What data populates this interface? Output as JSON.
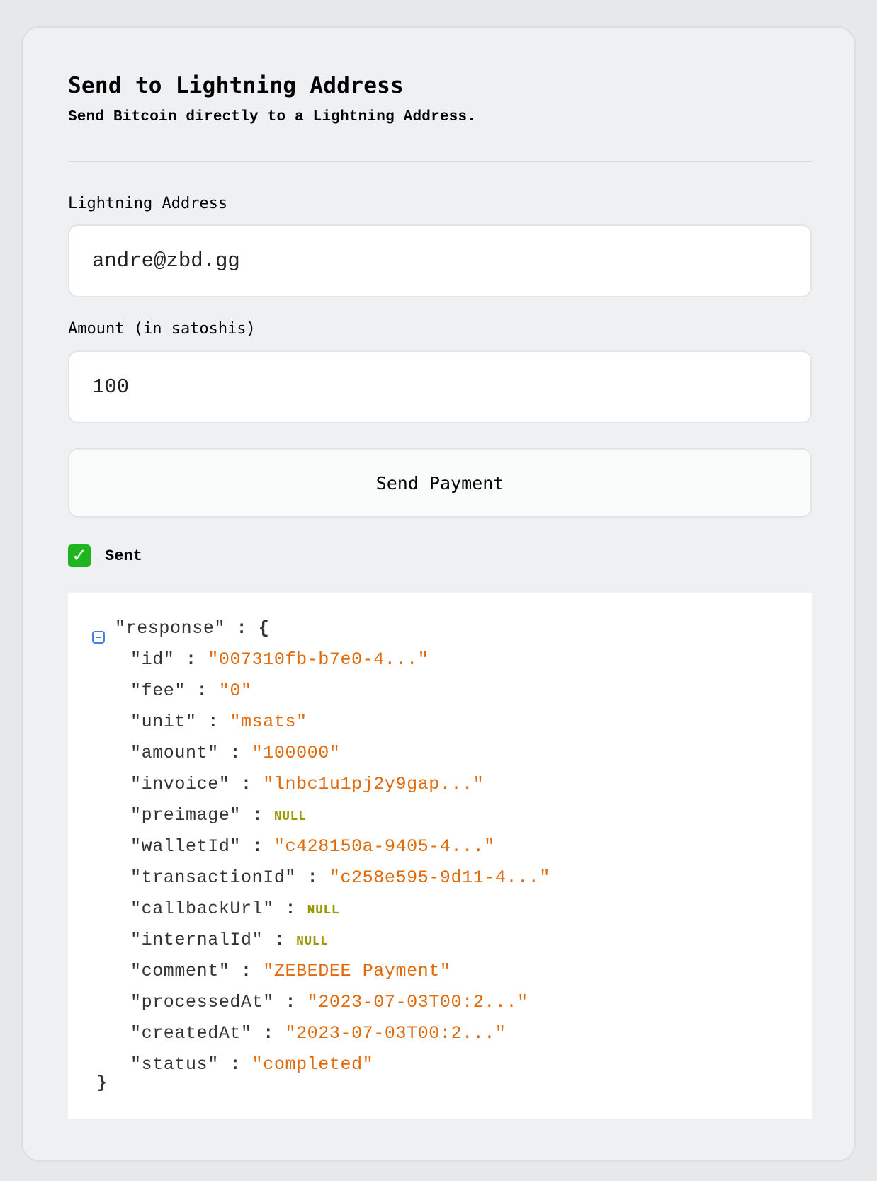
{
  "header": {
    "title": "Send to Lightning Address",
    "subtitle": "Send Bitcoin directly to a Lightning Address."
  },
  "form": {
    "address_label": "Lightning Address",
    "address_value": "andre@zbd.gg",
    "amount_label": "Amount (in satoshis)",
    "amount_value": "100",
    "submit_label": "Send Payment"
  },
  "status": {
    "icon": "check-mark-icon",
    "text": "Sent"
  },
  "colors": {
    "value": "#e06a0c",
    "null": "#9a9a00",
    "success": "#1fb51f"
  },
  "response": {
    "root_key": "\"response\"",
    "open": "{",
    "close": "}",
    "fields": [
      {
        "key": "\"id\"",
        "value": "\"007310fb-b7e0-4...\"",
        "type": "string"
      },
      {
        "key": "\"fee\"",
        "value": "\"0\"",
        "type": "string"
      },
      {
        "key": "\"unit\"",
        "value": "\"msats\"",
        "type": "string"
      },
      {
        "key": "\"amount\"",
        "value": "\"100000\"",
        "type": "string"
      },
      {
        "key": "\"invoice\"",
        "value": "\"lnbc1u1pj2y9gap...\"",
        "type": "string"
      },
      {
        "key": "\"preimage\"",
        "value": "NULL",
        "type": "null"
      },
      {
        "key": "\"walletId\"",
        "value": "\"c428150a-9405-4...\"",
        "type": "string"
      },
      {
        "key": "\"transactionId\"",
        "value": "\"c258e595-9d11-4...\"",
        "type": "string"
      },
      {
        "key": "\"callbackUrl\"",
        "value": "NULL",
        "type": "null"
      },
      {
        "key": "\"internalId\"",
        "value": "NULL",
        "type": "null"
      },
      {
        "key": "\"comment\"",
        "value": "\"ZEBEDEE Payment\"",
        "type": "string"
      },
      {
        "key": "\"processedAt\"",
        "value": "\"2023-07-03T00:2...\"",
        "type": "string"
      },
      {
        "key": "\"createdAt\"",
        "value": "\"2023-07-03T00:2...\"",
        "type": "string"
      },
      {
        "key": "\"status\"",
        "value": "\"completed\"",
        "type": "string"
      }
    ]
  }
}
